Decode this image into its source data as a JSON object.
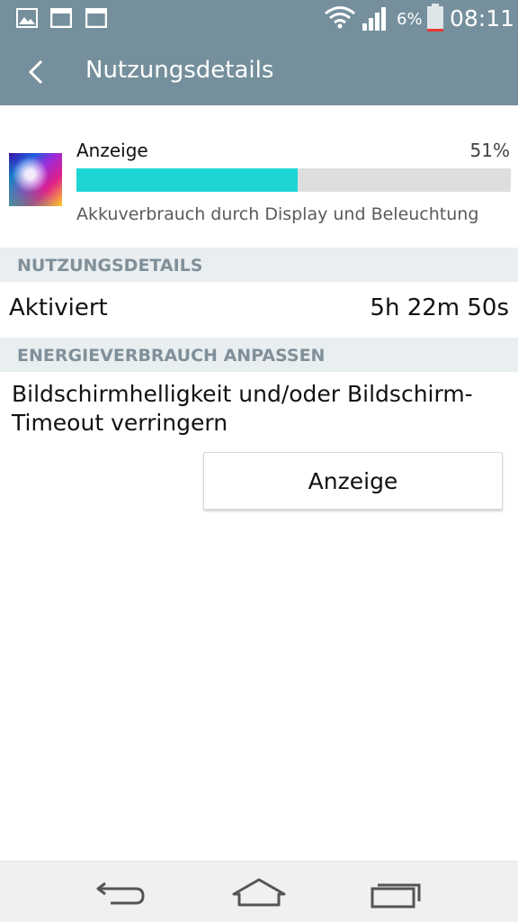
{
  "status_bar": {
    "battery_percent": "6%",
    "time": "08:11",
    "icons": [
      "image-icon",
      "window-icon",
      "window-icon",
      "wifi-icon",
      "signal-icon",
      "battery-icon"
    ]
  },
  "appbar": {
    "title": "Nutzungsdetails"
  },
  "usage": {
    "name": "Anzeige",
    "percent": "51%",
    "level": 0.51,
    "description": "Akkuverbrauch durch Display und Beleuchtung",
    "bar_color": "#1dd6d3"
  },
  "sections": {
    "usage_details": "NUTZUNGSDETAILS",
    "adjust_power": "ENERGIEVERBRAUCH ANPASSEN"
  },
  "details": {
    "label": "Aktiviert",
    "value": "5h 22m 50s"
  },
  "advice": {
    "text": "Bildschirmhelligkeit und/oder Bildschirm-Timeout verringern",
    "button_label": "Anzeige"
  },
  "navigation": {
    "icons": [
      "back-icon",
      "home-icon",
      "recent-apps-icon"
    ]
  },
  "colors": {
    "header": "#75909c",
    "section_bg": "#e9eef0",
    "section_text": "#80909a"
  }
}
